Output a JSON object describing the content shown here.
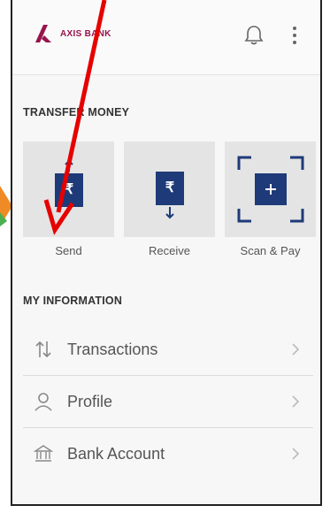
{
  "header": {
    "bank_name": "AXIS BANK",
    "icons": [
      "axis-bank-logo-icon",
      "bell-icon",
      "more-vert-icon"
    ]
  },
  "transfer": {
    "title": "TRANSFER MONEY",
    "tiles": [
      {
        "label": "Send",
        "icon": "send-rupee-icon"
      },
      {
        "label": "Receive",
        "icon": "receive-rupee-icon"
      },
      {
        "label": "Scan & Pay",
        "icon": "scan-pay-icon"
      }
    ]
  },
  "info": {
    "title": "MY INFORMATION",
    "items": [
      {
        "label": "Transactions",
        "icon": "transactions-icon"
      },
      {
        "label": "Profile",
        "icon": "profile-icon"
      },
      {
        "label": "Bank Account",
        "icon": "bank-icon"
      }
    ]
  },
  "colors": {
    "brand": "#97144d",
    "tile_icon": "#1e3a78",
    "annotation_arrow": "#e60000"
  }
}
